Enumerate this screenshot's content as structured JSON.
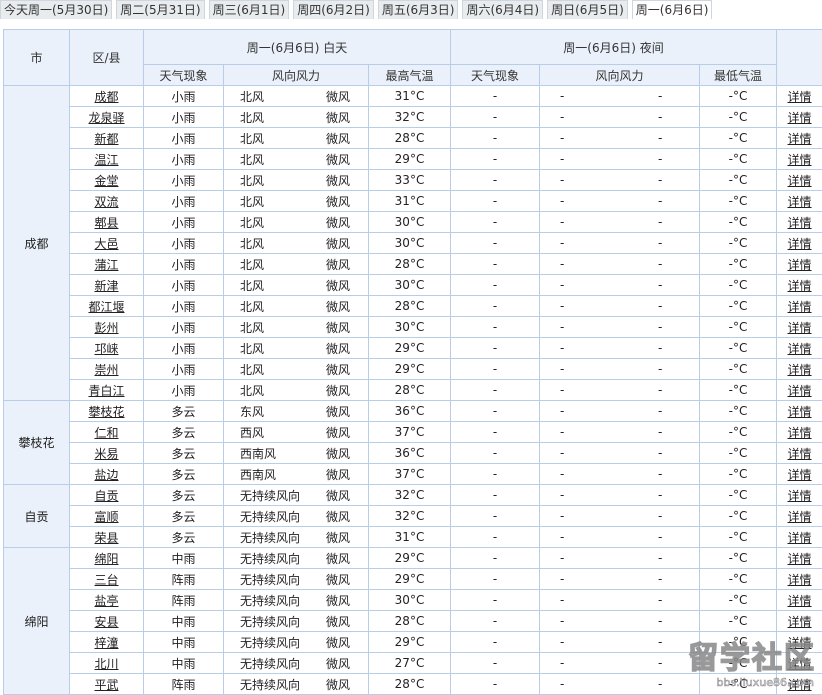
{
  "tabs": [
    "今天周一(5月30日)",
    "周二(5月31日)",
    "周三(6月1日)",
    "周四(6月2日)",
    "周五(6月3日)",
    "周六(6月4日)",
    "周日(6月5日)",
    "周一(6月6日)"
  ],
  "active_tab": 7,
  "header": {
    "city": "市",
    "district": "区/县",
    "day_group": "周一(6月6日) 白天",
    "night_group": "周一(6月6日) 夜间",
    "day_weather": "天气现象",
    "day_wind": "风向风力",
    "day_high": "最高气温",
    "night_weather": "天气现象",
    "night_wind": "风向风力",
    "night_low": "最低气温"
  },
  "placeholders": {
    "dash": "-",
    "night_temp": "-°C"
  },
  "detail_label": "详情",
  "groups": [
    {
      "city": "成都",
      "rows": [
        {
          "district": "成都",
          "weather": "小雨",
          "dir": "北风",
          "power": "微风",
          "high": "31°C"
        },
        {
          "district": "龙泉驿",
          "weather": "小雨",
          "dir": "北风",
          "power": "微风",
          "high": "32°C"
        },
        {
          "district": "新都",
          "weather": "小雨",
          "dir": "北风",
          "power": "微风",
          "high": "28°C"
        },
        {
          "district": "温江",
          "weather": "小雨",
          "dir": "北风",
          "power": "微风",
          "high": "29°C"
        },
        {
          "district": "金堂",
          "weather": "小雨",
          "dir": "北风",
          "power": "微风",
          "high": "33°C"
        },
        {
          "district": "双流",
          "weather": "小雨",
          "dir": "北风",
          "power": "微风",
          "high": "31°C"
        },
        {
          "district": "郫县",
          "weather": "小雨",
          "dir": "北风",
          "power": "微风",
          "high": "30°C"
        },
        {
          "district": "大邑",
          "weather": "小雨",
          "dir": "北风",
          "power": "微风",
          "high": "30°C"
        },
        {
          "district": "蒲江",
          "weather": "小雨",
          "dir": "北风",
          "power": "微风",
          "high": "28°C"
        },
        {
          "district": "新津",
          "weather": "小雨",
          "dir": "北风",
          "power": "微风",
          "high": "30°C"
        },
        {
          "district": "都江堰",
          "weather": "小雨",
          "dir": "北风",
          "power": "微风",
          "high": "28°C"
        },
        {
          "district": "彭州",
          "weather": "小雨",
          "dir": "北风",
          "power": "微风",
          "high": "30°C"
        },
        {
          "district": "邛崃",
          "weather": "小雨",
          "dir": "北风",
          "power": "微风",
          "high": "29°C"
        },
        {
          "district": "崇州",
          "weather": "小雨",
          "dir": "北风",
          "power": "微风",
          "high": "29°C"
        },
        {
          "district": "青白江",
          "weather": "小雨",
          "dir": "北风",
          "power": "微风",
          "high": "28°C"
        }
      ]
    },
    {
      "city": "攀枝花",
      "rows": [
        {
          "district": "攀枝花",
          "weather": "多云",
          "dir": "东风",
          "power": "微风",
          "high": "36°C"
        },
        {
          "district": "仁和",
          "weather": "多云",
          "dir": "西风",
          "power": "微风",
          "high": "37°C"
        },
        {
          "district": "米易",
          "weather": "多云",
          "dir": "西南风",
          "power": "微风",
          "high": "36°C"
        },
        {
          "district": "盐边",
          "weather": "多云",
          "dir": "西南风",
          "power": "微风",
          "high": "37°C"
        }
      ]
    },
    {
      "city": "自贡",
      "rows": [
        {
          "district": "自贡",
          "weather": "多云",
          "dir": "无持续风向",
          "power": "微风",
          "high": "32°C"
        },
        {
          "district": "富顺",
          "weather": "多云",
          "dir": "无持续风向",
          "power": "微风",
          "high": "32°C"
        },
        {
          "district": "荣县",
          "weather": "多云",
          "dir": "无持续风向",
          "power": "微风",
          "high": "31°C"
        }
      ]
    },
    {
      "city": "绵阳",
      "rows": [
        {
          "district": "绵阳",
          "weather": "中雨",
          "dir": "无持续风向",
          "power": "微风",
          "high": "29°C"
        },
        {
          "district": "三台",
          "weather": "阵雨",
          "dir": "无持续风向",
          "power": "微风",
          "high": "29°C"
        },
        {
          "district": "盐亭",
          "weather": "阵雨",
          "dir": "无持续风向",
          "power": "微风",
          "high": "30°C"
        },
        {
          "district": "安县",
          "weather": "中雨",
          "dir": "无持续风向",
          "power": "微风",
          "high": "28°C"
        },
        {
          "district": "梓潼",
          "weather": "中雨",
          "dir": "无持续风向",
          "power": "微风",
          "high": "29°C"
        },
        {
          "district": "北川",
          "weather": "中雨",
          "dir": "无持续风向",
          "power": "微风",
          "high": "27°C"
        },
        {
          "district": "平武",
          "weather": "阵雨",
          "dir": "无持续风向",
          "power": "微风",
          "high": "28°C"
        }
      ]
    }
  ],
  "watermark": {
    "big": "留学社区",
    "small": "bbs.liuxue86.com"
  }
}
